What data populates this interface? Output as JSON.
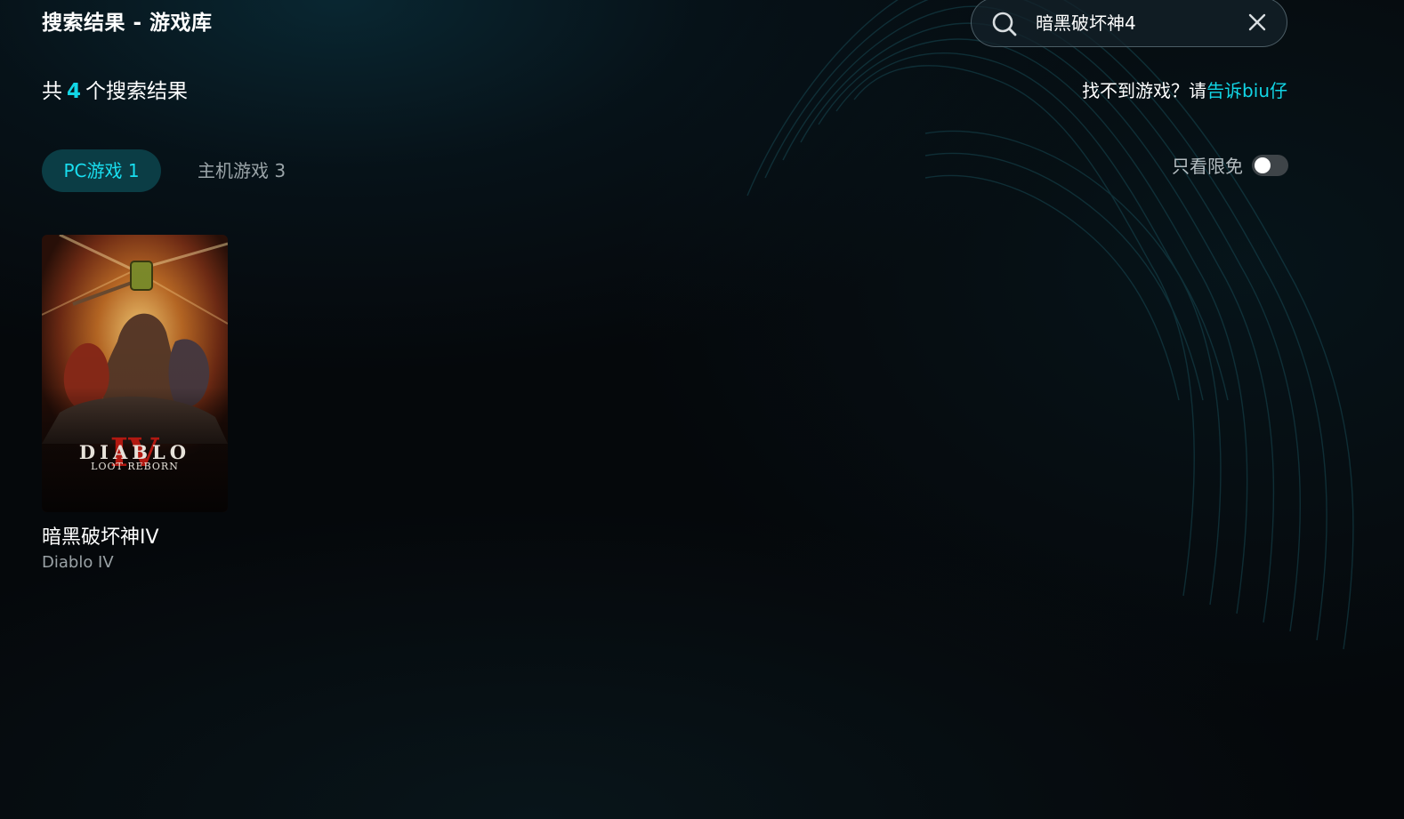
{
  "header": {
    "title": "搜索结果 - 游戏库"
  },
  "search": {
    "query": "暗黑破坏神4",
    "icon": "search-icon",
    "clear_icon": "close-icon"
  },
  "results": {
    "prefix": "共",
    "count": "4",
    "suffix": "个搜索结果"
  },
  "help": {
    "text": "找不到游戏？请",
    "link": "告诉biu仔"
  },
  "tabs": [
    {
      "label": "PC游戏 1",
      "active": true
    },
    {
      "label": "主机游戏 3",
      "active": false
    }
  ],
  "filter": {
    "label": "只看限免",
    "enabled": false
  },
  "games": [
    {
      "name": "暗黑破坏神IV",
      "english_name": "Diablo IV",
      "cover_title": "DIABLO",
      "cover_numeral": "IV",
      "cover_subtitle": "LOOT REBORN"
    }
  ],
  "colors": {
    "accent": "#12d6e6",
    "tab_active_bg": "#0b3d45",
    "background": "#05080b"
  }
}
